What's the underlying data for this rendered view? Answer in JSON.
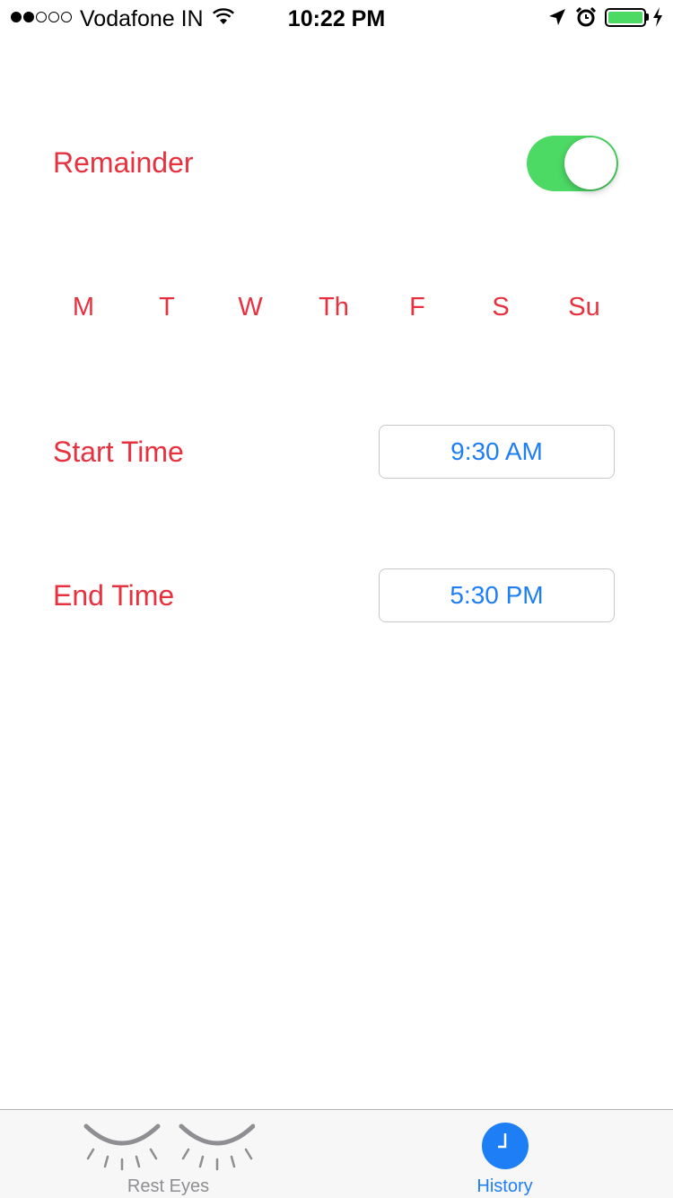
{
  "status_bar": {
    "carrier": "Vodafone IN",
    "time": "10:22 PM",
    "signal_bars_filled": 2,
    "signal_bars_total": 5,
    "battery_color": "#4cd964"
  },
  "settings": {
    "remainder_label": "Remainder",
    "remainder_enabled": true,
    "days": [
      "M",
      "T",
      "W",
      "Th",
      "F",
      "S",
      "Su"
    ],
    "start_time_label": "Start Time",
    "start_time_value": "9:30 AM",
    "end_time_label": "End Time",
    "end_time_value": "5:30 PM"
  },
  "tab_bar": {
    "tabs": [
      {
        "label": "Rest Eyes",
        "icon": "closed-eyes-icon",
        "selected": false
      },
      {
        "label": "History",
        "icon": "clock-icon",
        "selected": true
      }
    ]
  },
  "colors": {
    "label_red": "#e8313f",
    "accent_blue": "#1e7ef5",
    "toggle_green": "#4cd964",
    "tab_inactive": "#8e8e93"
  }
}
